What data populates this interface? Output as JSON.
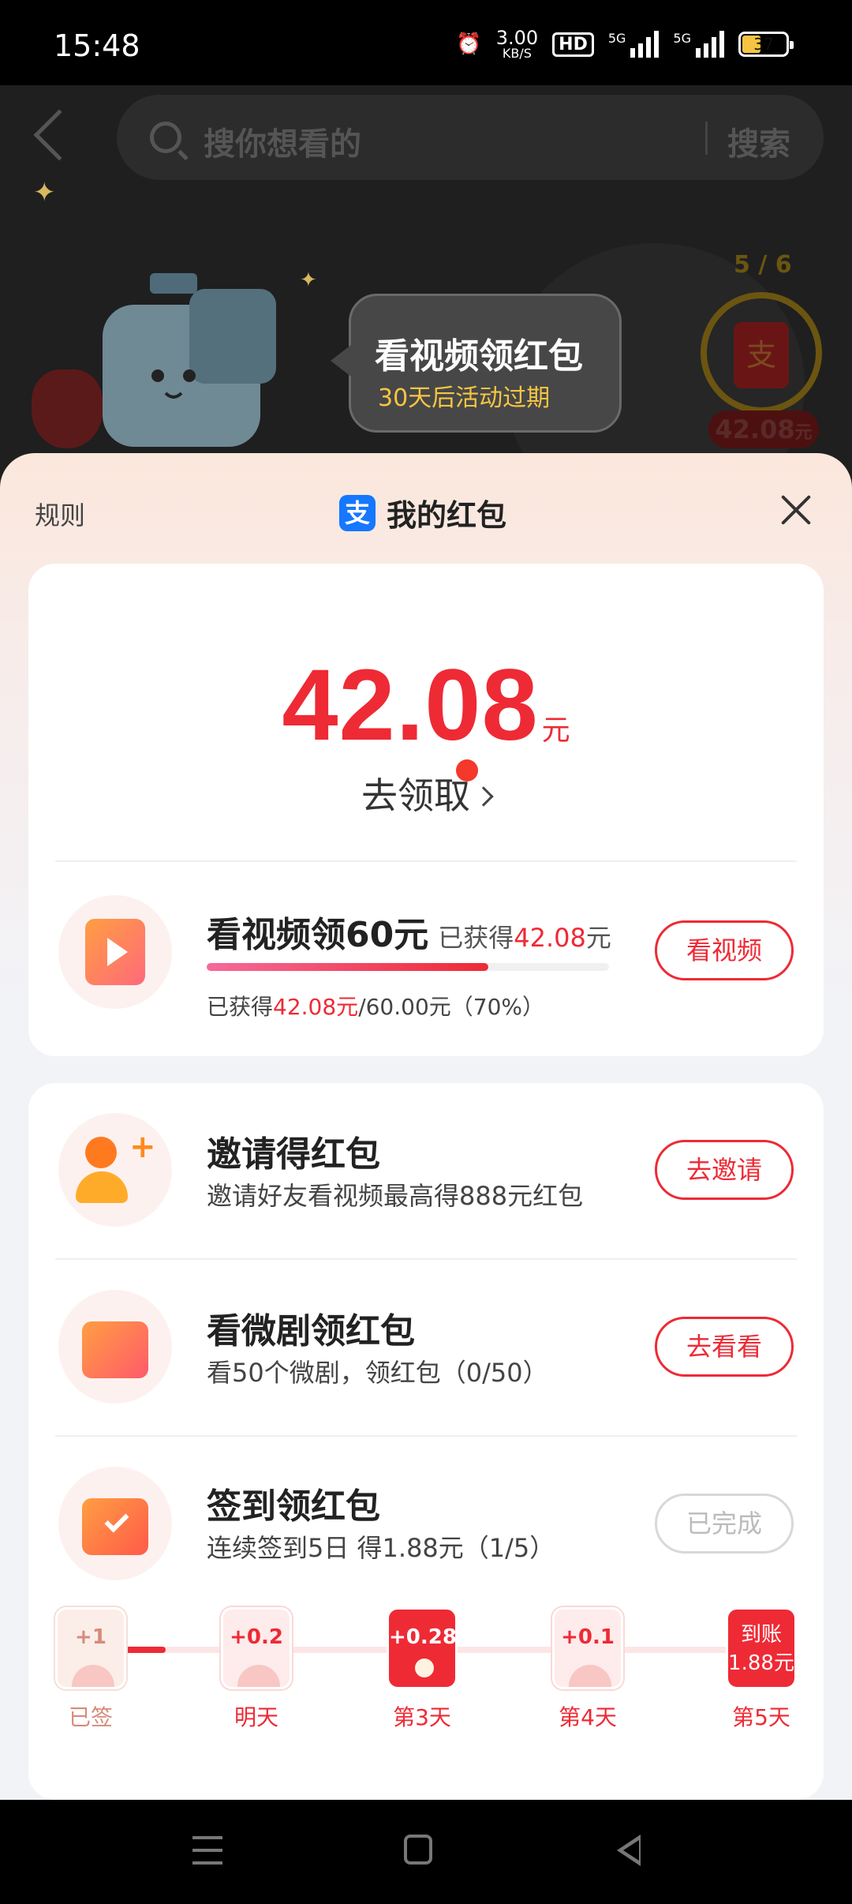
{
  "status_bar": {
    "time": "15:48",
    "net_speed": "3.00",
    "net_unit": "KB/S",
    "hd": "HD",
    "sig1": "5G",
    "sig2": "5G",
    "battery": "37"
  },
  "background_app": {
    "search_placeholder": "搜你想看的",
    "search_button": "搜索",
    "progress": "5 / 6",
    "ring_amount": "42.08",
    "ring_unit": "元",
    "ring_icon": "支",
    "bubble_title": "看视频领红包",
    "bubble_sub": "30天后活动过期"
  },
  "sheet": {
    "rules": "规则",
    "alipay_icon": "支",
    "title": "我的红包"
  },
  "balance": {
    "amount": "42.08",
    "unit": "元",
    "claim": "去领取"
  },
  "video_task": {
    "title": "看视频领60元",
    "side_prefix": "已获得",
    "side_amount": "42.08",
    "side_unit": "元",
    "progress_prefix": "已获得",
    "progress_amount": "42.08元",
    "progress_suffix": "/60.00元（70%）",
    "progress_value": 0.7,
    "button": "看视频"
  },
  "tasks": [
    {
      "title": "邀请得红包",
      "sub": "邀请好友看视频最高得888元红包",
      "button": "去邀请"
    },
    {
      "title": "看微剧领红包",
      "sub": "看50个微剧，领红包（0/50）",
      "button": "去看看"
    },
    {
      "title": "签到领红包",
      "sub": "连续签到5日 得1.88元（1/5）",
      "button": "已完成"
    }
  ],
  "checkin": {
    "days": [
      {
        "value": "+1",
        "label": "已签"
      },
      {
        "value": "+0.2",
        "label": "明天"
      },
      {
        "value": "+0.28",
        "label": "第3天"
      },
      {
        "value": "+0.1",
        "label": "第4天"
      },
      {
        "value": "到账",
        "value2": "1.88元",
        "label": "第5天"
      }
    ]
  },
  "colors": {
    "accent": "#ee2a35",
    "alipay": "#1677ff"
  }
}
